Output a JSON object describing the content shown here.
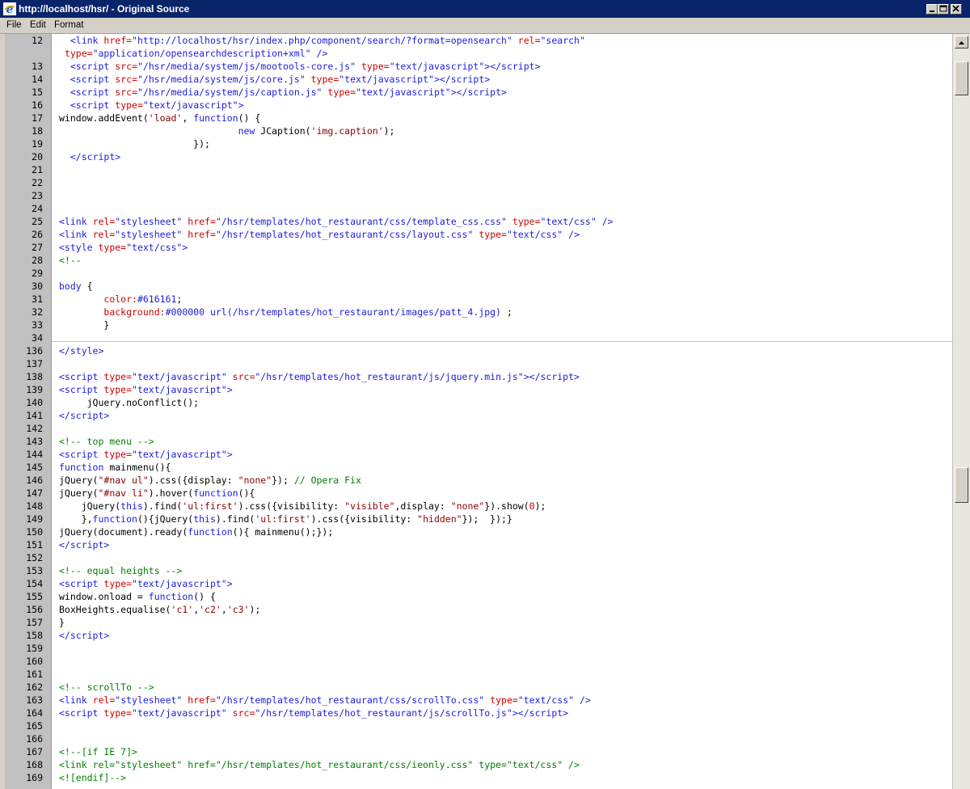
{
  "window": {
    "title": "http://localhost/hsr/ - Original Source"
  },
  "menu": [
    "File",
    "Edit",
    "Format"
  ],
  "icons": {
    "app": "ie-icon",
    "minimize": "minimize-icon",
    "maximize": "maximize-icon",
    "close": "close-icon"
  },
  "lines": [
    {
      "num": "12",
      "html": "<span class=\"t\">&lt;link</span> <span class=\"a\">href=</span><span class=\"s\">\"http://localhost/hsr/index.php/component/search/?format=opensearch\"</span> <span class=\"a\">rel=</span><span class=\"s\">\"search\"</span>",
      "indent": "  "
    },
    {
      "num": "",
      "html": " <span class=\"a\">type=</span><span class=\"s\">\"application/opensearchdescription+xml\"</span> <span class=\"t\">/&gt;</span>",
      "indent": ""
    },
    {
      "num": "13",
      "html": "<span class=\"t\">&lt;script</span> <span class=\"a\">src=</span><span class=\"s\">\"/hsr/media/system/js/mootools-core.js\"</span> <span class=\"a\">type=</span><span class=\"s\">\"text/javascript\"</span><span class=\"t\">&gt;&lt;/script&gt;</span>",
      "indent": "  "
    },
    {
      "num": "14",
      "html": "<span class=\"t\">&lt;script</span> <span class=\"a\">src=</span><span class=\"s\">\"/hsr/media/system/js/core.js\"</span> <span class=\"a\">type=</span><span class=\"s\">\"text/javascript\"</span><span class=\"t\">&gt;&lt;/script&gt;</span>",
      "indent": "  "
    },
    {
      "num": "15",
      "html": "<span class=\"t\">&lt;script</span> <span class=\"a\">src=</span><span class=\"s\">\"/hsr/media/system/js/caption.js\"</span> <span class=\"a\">type=</span><span class=\"s\">\"text/javascript\"</span><span class=\"t\">&gt;&lt;/script&gt;</span>",
      "indent": "  "
    },
    {
      "num": "16",
      "html": "<span class=\"t\">&lt;script</span> <span class=\"a\">type=</span><span class=\"s\">\"text/javascript\"</span><span class=\"t\">&gt;</span>",
      "indent": "  "
    },
    {
      "num": "17",
      "html": "window.addEvent(<span class=\"st\">'load'</span>, <span class=\"k\">function</span>() {",
      "indent": ""
    },
    {
      "num": "18",
      "html": "                                <span class=\"k\">new</span> JCaption(<span class=\"st\">'img.caption'</span>);",
      "indent": ""
    },
    {
      "num": "19",
      "html": "                        });",
      "indent": ""
    },
    {
      "num": "20",
      "html": "<span class=\"t\">&lt;/script&gt;</span>",
      "indent": "  "
    },
    {
      "num": "21",
      "html": "",
      "indent": ""
    },
    {
      "num": "22",
      "html": "",
      "indent": ""
    },
    {
      "num": "23",
      "html": "",
      "indent": ""
    },
    {
      "num": "24",
      "html": "",
      "indent": ""
    },
    {
      "num": "25",
      "html": "<span class=\"t\">&lt;link</span> <span class=\"a\">rel=</span><span class=\"s\">\"stylesheet\"</span> <span class=\"a\">href=</span><span class=\"s\">\"/hsr/templates/hot_restaurant/css/template_css.css\"</span> <span class=\"a\">type=</span><span class=\"s\">\"text/css\"</span> <span class=\"t\">/&gt;</span>",
      "indent": ""
    },
    {
      "num": "26",
      "html": "<span class=\"t\">&lt;link</span> <span class=\"a\">rel=</span><span class=\"s\">\"stylesheet\"</span> <span class=\"a\">href=</span><span class=\"s\">\"/hsr/templates/hot_restaurant/css/layout.css\"</span> <span class=\"a\">type=</span><span class=\"s\">\"text/css\"</span> <span class=\"t\">/&gt;</span>",
      "indent": ""
    },
    {
      "num": "27",
      "html": "<span class=\"t\">&lt;style</span> <span class=\"a\">type=</span><span class=\"s\">\"text/css\"</span><span class=\"t\">&gt;</span>",
      "indent": ""
    },
    {
      "num": "28",
      "html": "<span class=\"c\">&lt;!--</span>",
      "indent": ""
    },
    {
      "num": "29",
      "html": "",
      "indent": ""
    },
    {
      "num": "30",
      "html": "<span class=\"t\">body</span> {",
      "indent": ""
    },
    {
      "num": "31",
      "html": "        <span class=\"n\">color:</span><span class=\"t\">#616161</span>;",
      "indent": ""
    },
    {
      "num": "32",
      "html": "        <span class=\"n\">background:</span><span class=\"t\">#000000 url(/hsr/templates/hot_restaurant/images/patt_4.jpg)</span> ;",
      "indent": ""
    },
    {
      "num": "33",
      "html": "        }",
      "indent": ""
    },
    {
      "num": "34",
      "html": "",
      "indent": ""
    },
    {
      "num": "136",
      "html": "<span class=\"t\">&lt;/style&gt;</span>",
      "indent": ""
    },
    {
      "num": "137",
      "html": "",
      "indent": ""
    },
    {
      "num": "138",
      "html": "<span class=\"t\">&lt;script</span> <span class=\"a\">type=</span><span class=\"s\">\"text/javascript\"</span> <span class=\"a\">src=</span><span class=\"s\">\"/hsr/templates/hot_restaurant/js/jquery.min.js\"</span><span class=\"t\">&gt;&lt;/script&gt;</span>",
      "indent": ""
    },
    {
      "num": "139",
      "html": "<span class=\"t\">&lt;script</span> <span class=\"a\">type=</span><span class=\"s\">\"text/javascript\"</span><span class=\"t\">&gt;</span>",
      "indent": ""
    },
    {
      "num": "140",
      "html": "     jQuery.noConflict();",
      "indent": ""
    },
    {
      "num": "141",
      "html": "<span class=\"t\">&lt;/script&gt;</span>",
      "indent": ""
    },
    {
      "num": "142",
      "html": "",
      "indent": ""
    },
    {
      "num": "143",
      "html": "<span class=\"c\">&lt;!-- top menu --&gt;</span>",
      "indent": ""
    },
    {
      "num": "144",
      "html": "<span class=\"t\">&lt;script</span> <span class=\"a\">type=</span><span class=\"s\">\"text/javascript\"</span><span class=\"t\">&gt;</span>",
      "indent": ""
    },
    {
      "num": "145",
      "html": "<span class=\"k\">function</span> mainmenu(){",
      "indent": ""
    },
    {
      "num": "146",
      "html": "jQuery(<span class=\"st\">\"#nav ul\"</span>).css({display: <span class=\"st\">\"none\"</span>}); <span class=\"c\">// Opera Fix</span>",
      "indent": ""
    },
    {
      "num": "147",
      "html": "jQuery(<span class=\"st\">\"#nav li\"</span>).hover(<span class=\"k\">function</span>(){",
      "indent": ""
    },
    {
      "num": "148",
      "html": "    jQuery(<span class=\"k\">this</span>).find(<span class=\"st\">'ul:first'</span>).css({visibility: <span class=\"st\">\"visible\"</span>,display: <span class=\"st\">\"none\"</span>}).show(<span class=\"n\">0</span>);",
      "indent": ""
    },
    {
      "num": "149",
      "html": "    },<span class=\"k\">function</span>(){jQuery(<span class=\"k\">this</span>).find(<span class=\"st\">'ul:first'</span>).css({visibility: <span class=\"st\">\"hidden\"</span>});  });}",
      "indent": ""
    },
    {
      "num": "150",
      "html": "jQuery(document).ready(<span class=\"k\">function</span>(){ mainmenu();});",
      "indent": ""
    },
    {
      "num": "151",
      "html": "<span class=\"t\">&lt;/script&gt;</span>",
      "indent": ""
    },
    {
      "num": "152",
      "html": "",
      "indent": ""
    },
    {
      "num": "153",
      "html": "<span class=\"c\">&lt;!-- equal heights --&gt;</span>",
      "indent": ""
    },
    {
      "num": "154",
      "html": "<span class=\"t\">&lt;script</span> <span class=\"a\">type=</span><span class=\"s\">\"text/javascript\"</span><span class=\"t\">&gt;</span>",
      "indent": ""
    },
    {
      "num": "155",
      "html": "window.onload = <span class=\"k\">function</span>() {",
      "indent": ""
    },
    {
      "num": "156",
      "html": "BoxHeights.equalise(<span class=\"st\">'c1'</span>,<span class=\"st\">'c2'</span>,<span class=\"st\">'c3'</span>);",
      "indent": ""
    },
    {
      "num": "157",
      "html": "}",
      "indent": ""
    },
    {
      "num": "158",
      "html": "<span class=\"t\">&lt;/script&gt;</span>",
      "indent": ""
    },
    {
      "num": "159",
      "html": "",
      "indent": ""
    },
    {
      "num": "160",
      "html": "",
      "indent": ""
    },
    {
      "num": "161",
      "html": "",
      "indent": ""
    },
    {
      "num": "162",
      "html": "<span class=\"c\">&lt;!-- scrollTo --&gt;</span>",
      "indent": ""
    },
    {
      "num": "163",
      "html": "<span class=\"t\">&lt;link</span> <span class=\"a\">rel=</span><span class=\"s\">\"stylesheet\"</span> <span class=\"a\">href=</span><span class=\"s\">\"/hsr/templates/hot_restaurant/css/scrollTo.css\"</span> <span class=\"a\">type=</span><span class=\"s\">\"text/css\"</span> <span class=\"t\">/&gt;</span>",
      "indent": ""
    },
    {
      "num": "164",
      "html": "<span class=\"t\">&lt;script</span> <span class=\"a\">type=</span><span class=\"s\">\"text/javascript\"</span> <span class=\"a\">src=</span><span class=\"s\">\"/hsr/templates/hot_restaurant/js/scrollTo.js\"</span><span class=\"t\">&gt;&lt;/script&gt;</span>",
      "indent": ""
    },
    {
      "num": "165",
      "html": "",
      "indent": ""
    },
    {
      "num": "166",
      "html": "",
      "indent": ""
    },
    {
      "num": "167",
      "html": "<span class=\"c\">&lt;!--[if IE 7]&gt;</span>",
      "indent": ""
    },
    {
      "num": "168",
      "html": "<span class=\"c\">&lt;link rel=\"stylesheet\" href=\"/hsr/templates/hot_restaurant/css/ieonly.css\" type=\"text/css\" /&gt;</span>",
      "indent": ""
    },
    {
      "num": "169",
      "html": "<span class=\"c\">&lt;![endif]--&gt;</span>",
      "indent": ""
    }
  ],
  "scrollbar": {
    "up": "scroll-up-arrow-icon",
    "down": "scroll-down-arrow-icon"
  }
}
